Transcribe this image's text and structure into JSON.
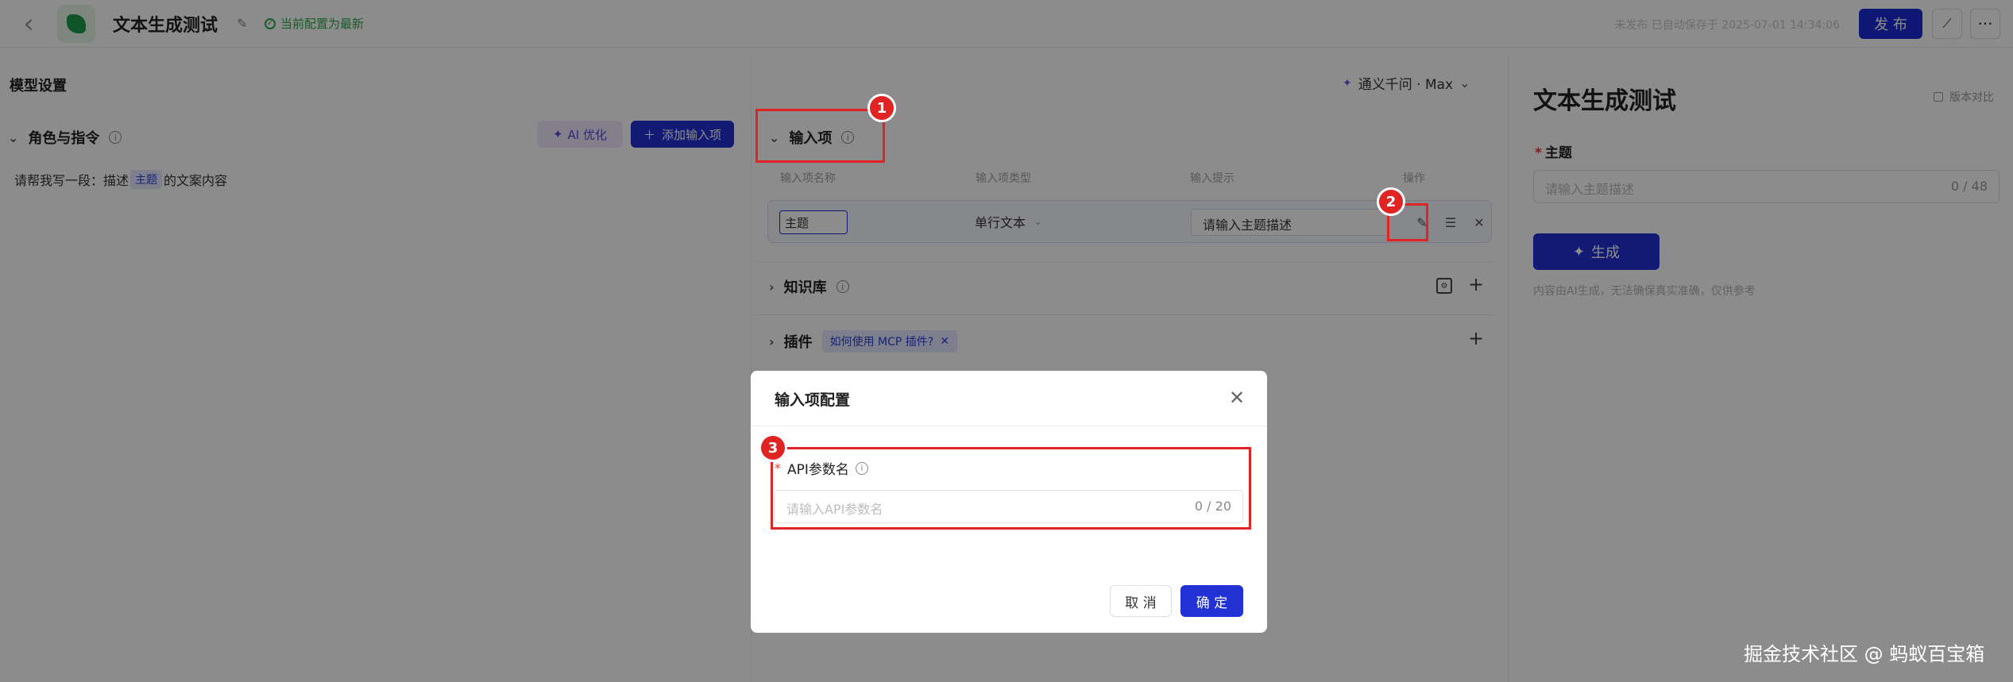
{
  "header": {
    "back_glyph": "‹",
    "title": "文本生成测试",
    "config_status": "当前配置为最新",
    "autosave": "未发布 已自动保存于 2025-07-01 14:34:06",
    "publish_label": "发 布",
    "chart_glyph": "⟋",
    "more_glyph": "···"
  },
  "model_settings": {
    "title": "模型设置",
    "model_name": "通义千问 · Max"
  },
  "left_pane": {
    "role_title": "角色与指令",
    "ai_optimize": "AI 优化",
    "add_input": "添加输入项",
    "prompt_prefix": "请帮我写一段：描述",
    "prompt_tag": "主题",
    "prompt_suffix": "的文案内容"
  },
  "inputs_section": {
    "title": "输入项",
    "columns": [
      "输入项名称",
      "输入项类型",
      "输入提示",
      "操作"
    ],
    "row": {
      "name": "主题",
      "type": "单行文本",
      "hint": "请输入主题描述"
    }
  },
  "knowledge": {
    "title": "知识库"
  },
  "plugins": {
    "title": "插件",
    "help_chip": "如何使用 MCP 插件?"
  },
  "preview": {
    "title": "文本生成测试",
    "version_compare": "版本对比",
    "field_label": "主题",
    "field_placeholder": "请输入主题描述",
    "field_count": "0 / 48",
    "generate_label": "生成",
    "disclaimer": "内容由AI生成，无法确保真实准确，仅供参考"
  },
  "modal": {
    "title": "输入项配置",
    "api_label": "API参数名",
    "api_placeholder": "请输入API参数名",
    "api_count": "0 / 20",
    "cancel": "取 消",
    "ok": "确 定"
  },
  "annotations": [
    "1",
    "2",
    "3"
  ],
  "watermark": "掘金技术社区 @ 蚂蚁百宝箱",
  "colors": {
    "primary": "#2231d3",
    "success": "#2fa84f",
    "annotation": "#e02424"
  }
}
